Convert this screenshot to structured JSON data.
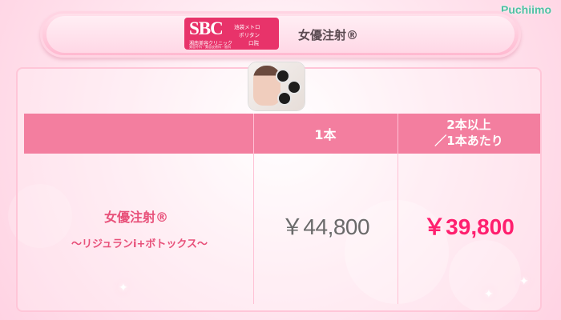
{
  "brand": {
    "name": "Puchiimo",
    "color": "#4fc1a3"
  },
  "header": {
    "logo": {
      "mark": "SBC",
      "line_right_1": "池袋メトロ",
      "line_right_2": "ポリタン",
      "line_right_3": "口院",
      "line_bottom_1": "湘南美容クリニック",
      "line_bottom_2": "美容外科・美容皮膚科・歯科"
    },
    "title": "女優注射®"
  },
  "product_image": {
    "icon": "product-photo-icon"
  },
  "table": {
    "headers": {
      "single": "1本",
      "multi_line1": "2本以上",
      "multi_line2": "／1本あたり"
    },
    "row": {
      "name_line1": "女優注射®",
      "name_line2": "～リジュランi+ボトックス～",
      "price_single": "￥44,800",
      "price_multi": "￥39,800"
    }
  },
  "colors": {
    "accent_pink": "#f37e9f",
    "price_highlight": "#ff1f6e",
    "logo_red": "#e8336a"
  }
}
